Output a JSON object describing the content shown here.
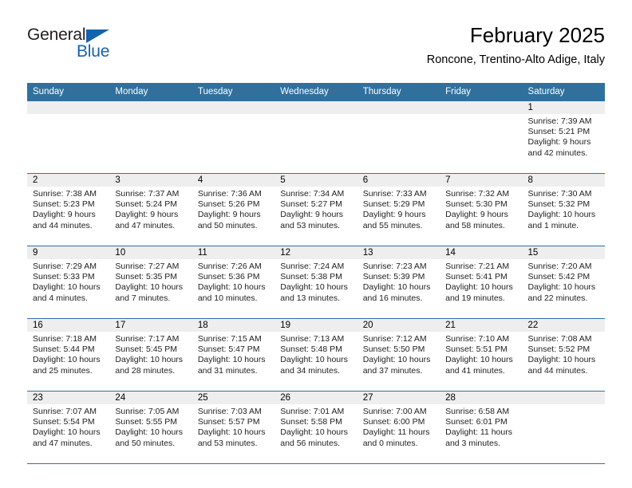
{
  "logo": {
    "word1": "General",
    "word2": "Blue",
    "accent_color": "#1463ac"
  },
  "header": {
    "title": "February 2025",
    "subtitle": "Roncone, Trentino-Alto Adige, Italy"
  },
  "calendar": {
    "header_color": "#31709c",
    "weekdays": [
      "Sunday",
      "Monday",
      "Tuesday",
      "Wednesday",
      "Thursday",
      "Friday",
      "Saturday"
    ],
    "weeks": [
      [
        {
          "day": "",
          "sunrise": "",
          "sunset": "",
          "daylight1": "",
          "daylight2": "",
          "empty": true
        },
        {
          "day": "",
          "sunrise": "",
          "sunset": "",
          "daylight1": "",
          "daylight2": "",
          "empty": true
        },
        {
          "day": "",
          "sunrise": "",
          "sunset": "",
          "daylight1": "",
          "daylight2": "",
          "empty": true
        },
        {
          "day": "",
          "sunrise": "",
          "sunset": "",
          "daylight1": "",
          "daylight2": "",
          "empty": true
        },
        {
          "day": "",
          "sunrise": "",
          "sunset": "",
          "daylight1": "",
          "daylight2": "",
          "empty": true
        },
        {
          "day": "",
          "sunrise": "",
          "sunset": "",
          "daylight1": "",
          "daylight2": "",
          "empty": true
        },
        {
          "day": "1",
          "sunrise": "Sunrise: 7:39 AM",
          "sunset": "Sunset: 5:21 PM",
          "daylight1": "Daylight: 9 hours",
          "daylight2": "and 42 minutes."
        }
      ],
      [
        {
          "day": "2",
          "sunrise": "Sunrise: 7:38 AM",
          "sunset": "Sunset: 5:23 PM",
          "daylight1": "Daylight: 9 hours",
          "daylight2": "and 44 minutes."
        },
        {
          "day": "3",
          "sunrise": "Sunrise: 7:37 AM",
          "sunset": "Sunset: 5:24 PM",
          "daylight1": "Daylight: 9 hours",
          "daylight2": "and 47 minutes."
        },
        {
          "day": "4",
          "sunrise": "Sunrise: 7:36 AM",
          "sunset": "Sunset: 5:26 PM",
          "daylight1": "Daylight: 9 hours",
          "daylight2": "and 50 minutes."
        },
        {
          "day": "5",
          "sunrise": "Sunrise: 7:34 AM",
          "sunset": "Sunset: 5:27 PM",
          "daylight1": "Daylight: 9 hours",
          "daylight2": "and 53 minutes."
        },
        {
          "day": "6",
          "sunrise": "Sunrise: 7:33 AM",
          "sunset": "Sunset: 5:29 PM",
          "daylight1": "Daylight: 9 hours",
          "daylight2": "and 55 minutes."
        },
        {
          "day": "7",
          "sunrise": "Sunrise: 7:32 AM",
          "sunset": "Sunset: 5:30 PM",
          "daylight1": "Daylight: 9 hours",
          "daylight2": "and 58 minutes."
        },
        {
          "day": "8",
          "sunrise": "Sunrise: 7:30 AM",
          "sunset": "Sunset: 5:32 PM",
          "daylight1": "Daylight: 10 hours",
          "daylight2": "and 1 minute."
        }
      ],
      [
        {
          "day": "9",
          "sunrise": "Sunrise: 7:29 AM",
          "sunset": "Sunset: 5:33 PM",
          "daylight1": "Daylight: 10 hours",
          "daylight2": "and 4 minutes."
        },
        {
          "day": "10",
          "sunrise": "Sunrise: 7:27 AM",
          "sunset": "Sunset: 5:35 PM",
          "daylight1": "Daylight: 10 hours",
          "daylight2": "and 7 minutes."
        },
        {
          "day": "11",
          "sunrise": "Sunrise: 7:26 AM",
          "sunset": "Sunset: 5:36 PM",
          "daylight1": "Daylight: 10 hours",
          "daylight2": "and 10 minutes."
        },
        {
          "day": "12",
          "sunrise": "Sunrise: 7:24 AM",
          "sunset": "Sunset: 5:38 PM",
          "daylight1": "Daylight: 10 hours",
          "daylight2": "and 13 minutes."
        },
        {
          "day": "13",
          "sunrise": "Sunrise: 7:23 AM",
          "sunset": "Sunset: 5:39 PM",
          "daylight1": "Daylight: 10 hours",
          "daylight2": "and 16 minutes."
        },
        {
          "day": "14",
          "sunrise": "Sunrise: 7:21 AM",
          "sunset": "Sunset: 5:41 PM",
          "daylight1": "Daylight: 10 hours",
          "daylight2": "and 19 minutes."
        },
        {
          "day": "15",
          "sunrise": "Sunrise: 7:20 AM",
          "sunset": "Sunset: 5:42 PM",
          "daylight1": "Daylight: 10 hours",
          "daylight2": "and 22 minutes."
        }
      ],
      [
        {
          "day": "16",
          "sunrise": "Sunrise: 7:18 AM",
          "sunset": "Sunset: 5:44 PM",
          "daylight1": "Daylight: 10 hours",
          "daylight2": "and 25 minutes."
        },
        {
          "day": "17",
          "sunrise": "Sunrise: 7:17 AM",
          "sunset": "Sunset: 5:45 PM",
          "daylight1": "Daylight: 10 hours",
          "daylight2": "and 28 minutes."
        },
        {
          "day": "18",
          "sunrise": "Sunrise: 7:15 AM",
          "sunset": "Sunset: 5:47 PM",
          "daylight1": "Daylight: 10 hours",
          "daylight2": "and 31 minutes."
        },
        {
          "day": "19",
          "sunrise": "Sunrise: 7:13 AM",
          "sunset": "Sunset: 5:48 PM",
          "daylight1": "Daylight: 10 hours",
          "daylight2": "and 34 minutes."
        },
        {
          "day": "20",
          "sunrise": "Sunrise: 7:12 AM",
          "sunset": "Sunset: 5:50 PM",
          "daylight1": "Daylight: 10 hours",
          "daylight2": "and 37 minutes."
        },
        {
          "day": "21",
          "sunrise": "Sunrise: 7:10 AM",
          "sunset": "Sunset: 5:51 PM",
          "daylight1": "Daylight: 10 hours",
          "daylight2": "and 41 minutes."
        },
        {
          "day": "22",
          "sunrise": "Sunrise: 7:08 AM",
          "sunset": "Sunset: 5:52 PM",
          "daylight1": "Daylight: 10 hours",
          "daylight2": "and 44 minutes."
        }
      ],
      [
        {
          "day": "23",
          "sunrise": "Sunrise: 7:07 AM",
          "sunset": "Sunset: 5:54 PM",
          "daylight1": "Daylight: 10 hours",
          "daylight2": "and 47 minutes."
        },
        {
          "day": "24",
          "sunrise": "Sunrise: 7:05 AM",
          "sunset": "Sunset: 5:55 PM",
          "daylight1": "Daylight: 10 hours",
          "daylight2": "and 50 minutes."
        },
        {
          "day": "25",
          "sunrise": "Sunrise: 7:03 AM",
          "sunset": "Sunset: 5:57 PM",
          "daylight1": "Daylight: 10 hours",
          "daylight2": "and 53 minutes."
        },
        {
          "day": "26",
          "sunrise": "Sunrise: 7:01 AM",
          "sunset": "Sunset: 5:58 PM",
          "daylight1": "Daylight: 10 hours",
          "daylight2": "and 56 minutes."
        },
        {
          "day": "27",
          "sunrise": "Sunrise: 7:00 AM",
          "sunset": "Sunset: 6:00 PM",
          "daylight1": "Daylight: 11 hours",
          "daylight2": "and 0 minutes."
        },
        {
          "day": "28",
          "sunrise": "Sunrise: 6:58 AM",
          "sunset": "Sunset: 6:01 PM",
          "daylight1": "Daylight: 11 hours",
          "daylight2": "and 3 minutes."
        },
        {
          "day": "",
          "sunrise": "",
          "sunset": "",
          "daylight1": "",
          "daylight2": "",
          "empty": true
        }
      ]
    ]
  }
}
